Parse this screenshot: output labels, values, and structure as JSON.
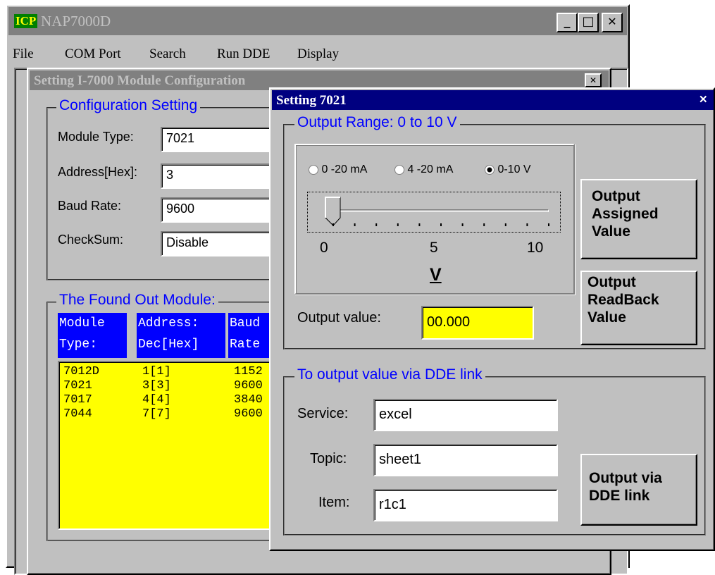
{
  "main_window": {
    "title": "NAP7000D",
    "logo": "ICP",
    "menu": [
      "File",
      "COM Port",
      "Search",
      "Run DDE",
      "Display"
    ],
    "controls": {
      "minimize": "_",
      "maximize": "□",
      "close": "✕"
    }
  },
  "config_window": {
    "title": "Setting I-7000 Module Configuration",
    "close": "✕",
    "config_group": {
      "title": "Configuration Setting",
      "module_type_label": "Module Type:",
      "module_type_value": "7021",
      "address_label": "Address[Hex]:",
      "address_value": "3",
      "baud_label": "Baud Rate:",
      "baud_value": "9600",
      "checksum_label": "CheckSum:",
      "checksum_value": "Disable"
    },
    "found_group": {
      "title": "The Found Out Module:",
      "headers": [
        {
          "line1": "Module",
          "line2": "Type:"
        },
        {
          "line1": "Address:",
          "line2": "Dec[Hex]"
        },
        {
          "line1": "Baud",
          "line2": "Rate"
        }
      ],
      "rows": [
        {
          "type": "7012D",
          "address": "1[1]",
          "baud": "1152"
        },
        {
          "type": "7021",
          "address": "3[3]",
          "baud": "9600"
        },
        {
          "type": "7017",
          "address": "4[4]",
          "baud": "3840"
        },
        {
          "type": "7044",
          "address": "7[7]",
          "baud": "9600"
        }
      ]
    }
  },
  "setting_dialog": {
    "title": "Setting 7021",
    "close": "✕",
    "range_group": {
      "title": "Output Range: 0 to 10 V",
      "radios": [
        {
          "label": "0 -20 mA",
          "checked": false
        },
        {
          "label": "4 -20 mA",
          "checked": false
        },
        {
          "label": "0-10 V",
          "checked": true
        }
      ],
      "slider_value": 0,
      "slider_min": 0,
      "slider_max": 10,
      "tick_labels": [
        "0",
        "5",
        "10"
      ],
      "unit": "V",
      "output_value_label": "Output value:",
      "output_value": "00.000"
    },
    "buttons": {
      "output_assigned": "Output Assigned Value",
      "output_readback": "Output ReadBack Value",
      "output_dde": "Output via DDE link"
    },
    "dde_group": {
      "title": "To output value via DDE link",
      "service_label": "Service:",
      "service_value": "excel",
      "topic_label": "Topic:",
      "topic_value": "sheet1",
      "item_label": "Item:",
      "item_value": "r1c1"
    },
    "colors": {
      "titlebar_active": "#000080",
      "group_title": "#0000ff",
      "highlight_yellow": "#ffff00"
    }
  }
}
